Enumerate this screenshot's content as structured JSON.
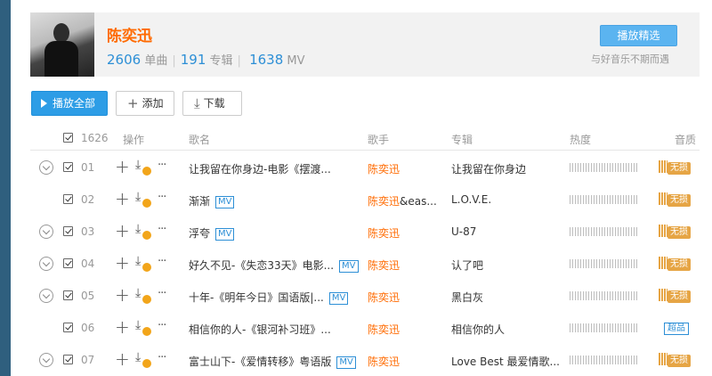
{
  "artist": {
    "name": "陈奕迅",
    "singles_count": "2606",
    "singles_label": "单曲",
    "albums_count": "191",
    "albums_label": "专辑",
    "mv_count": "1638",
    "mv_label": "MV",
    "play_select_label": "播放精选",
    "slogan": "与好音乐不期而遇"
  },
  "toolbar": {
    "play_all_label": "播放全部",
    "add_label": "添加",
    "download_label": "下载"
  },
  "table": {
    "count": "1626",
    "headers": {
      "ops": "操作",
      "title": "歌名",
      "singer": "歌手",
      "album": "专辑",
      "heat": "热度",
      "quality": "音质"
    },
    "rows": [
      {
        "index": "01",
        "title": "让我留在你身边-电影《摆渡...",
        "mv": "",
        "singer": "陈奕迅",
        "singer_rest": "",
        "album": "让我留在你身边",
        "quality": "无损",
        "quality_type": "lossless",
        "expandable": true
      },
      {
        "index": "02",
        "title": "渐渐",
        "mv": "MV",
        "singer": "陈奕迅",
        "singer_rest": "&eas...",
        "album": "L.O.V.E.",
        "quality": "无损",
        "quality_type": "lossless",
        "expandable": false
      },
      {
        "index": "03",
        "title": "浮夸",
        "mv": "MV",
        "singer": "陈奕迅",
        "singer_rest": "",
        "album": "U-87",
        "quality": "无损",
        "quality_type": "lossless",
        "expandable": true
      },
      {
        "index": "04",
        "title": "好久不见-《失恋33天》电影...",
        "mv": "MV",
        "singer": "陈奕迅",
        "singer_rest": "",
        "album": "认了吧",
        "quality": "无损",
        "quality_type": "lossless",
        "expandable": true
      },
      {
        "index": "05",
        "title": "十年-《明年今日》国语版|...",
        "mv": "MV",
        "singer": "陈奕迅",
        "singer_rest": "",
        "album": "黑白灰",
        "quality": "无损",
        "quality_type": "lossless",
        "expandable": true
      },
      {
        "index": "06",
        "title": "相信你的人-《银河补习班》...",
        "mv": "",
        "singer": "陈奕迅",
        "singer_rest": "",
        "album": "相信你的人",
        "quality": "超品",
        "quality_type": "super",
        "expandable": false
      },
      {
        "index": "07",
        "title": "富士山下-《爱情转移》粤语版",
        "mv": "MV",
        "singer": "陈奕迅",
        "singer_rest": "",
        "album": "Love Best 最爱情歌...",
        "quality": "无损",
        "quality_type": "lossless",
        "expandable": true
      }
    ]
  },
  "colors": {
    "accent_orange": "#ff6a00",
    "link_blue": "#2d8fd6",
    "primary_button": "#2d9de6",
    "lossless_gold": "#e6a545"
  }
}
